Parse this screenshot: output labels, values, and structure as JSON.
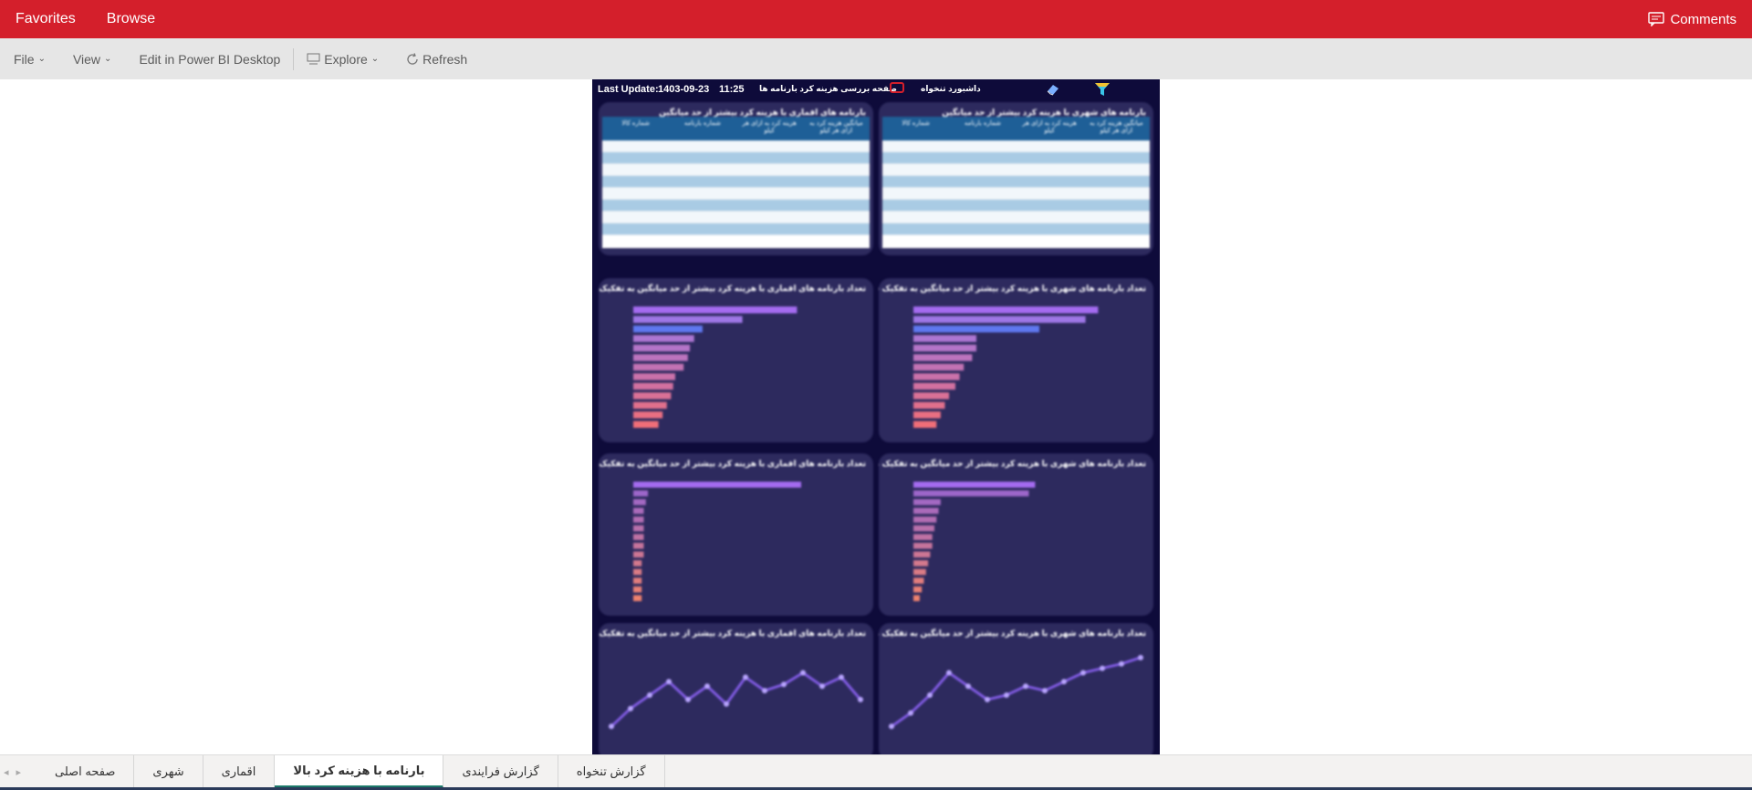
{
  "topbar": {
    "favorites": "Favorites",
    "browse": "Browse",
    "comments": "Comments"
  },
  "toolbar": {
    "file": "File",
    "view": "View",
    "edit": "Edit in Power BI Desktop",
    "explore": "Explore",
    "refresh": "Refresh"
  },
  "report": {
    "last_update_label": "Last Update:",
    "date": "1403-09-23",
    "time": "11:25",
    "page_title": "صفحه بررسی هزینه کرد بارنامه ها",
    "dashboard_title": "داشبورد تنخواه",
    "panels": {
      "table_right_title": "بارنامه های شهری با هزینه کرد بیشتر از حد میانگین",
      "table_left_title": "بارنامه های اقماری با هزینه کرد بیشتر از حد میانگین",
      "table_columns": [
        "میانگین هزینه کرد به ازای هر کیلو",
        "هزینه کرد به ازای هر کیلو",
        "شماره بارنامه",
        "شماره کالا"
      ],
      "branch_right_title": "تعداد بارنامه های شهری با هزینه کرد بیشتر از حد میانگین به تفکیک شعبه",
      "branch_left_title": "تعداد بارنامه های اقماری با هزینه کرد بیشتر از حد میانگین به تفکیک شعبه",
      "customer_right_title": "تعداد بارنامه های شهری با هزینه کرد بیشتر از حد میانگین به تفکیک مشتری",
      "customer_left_title": "تعداد بارنامه های اقماری با هزینه کرد بیشتر از حد میانگین به تفکیک مشتری",
      "month_right_title": "تعداد بارنامه های شهری با هزینه کرد بیشتر از حد میانگین به تفکیک ماه",
      "month_left_title": "تعداد بارنامه های اقماری با هزینه کرد بیشتر از حد میانگین به تفکیک ماه"
    }
  },
  "tabs": [
    {
      "label": "صفحه اصلی"
    },
    {
      "label": "شهری"
    },
    {
      "label": "اقماری"
    },
    {
      "label": "بارنامه با هزینه کرد بالا"
    },
    {
      "label": "گزارش فرایندی"
    },
    {
      "label": "گزارش تنخواه"
    }
  ],
  "colors": {
    "brand": "#d41f2b",
    "report_bg": "#0e0b3a",
    "panel_bg": "#2d2a5e",
    "active_tab_underline": "#1e7a6a"
  }
}
